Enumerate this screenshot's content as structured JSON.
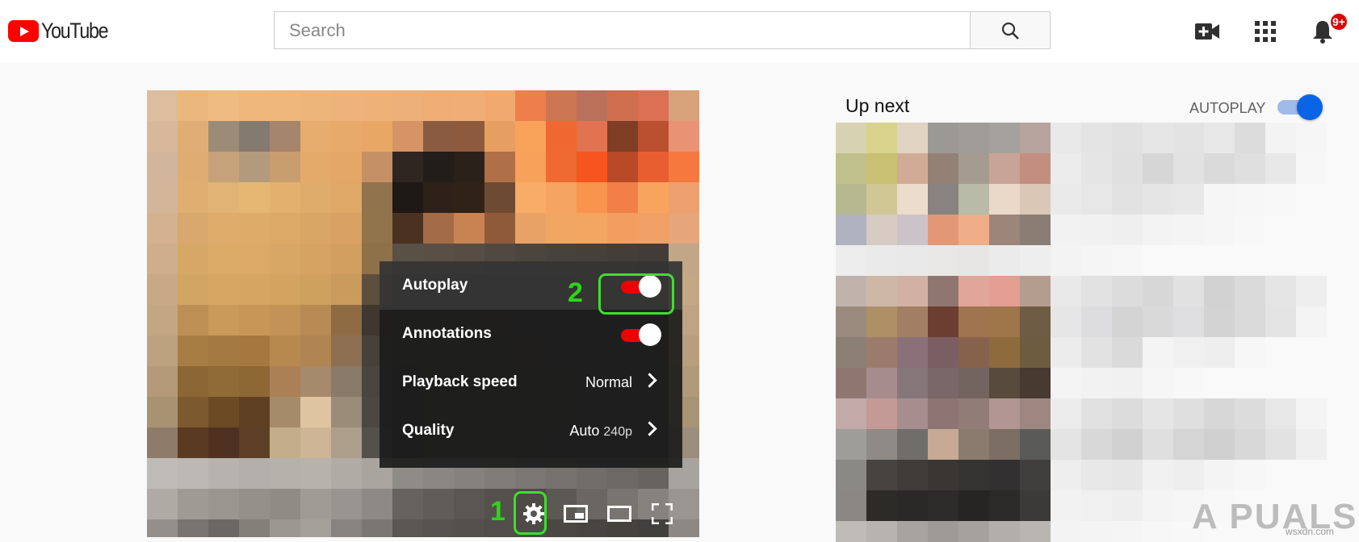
{
  "header": {
    "brand": "YouTube",
    "search_placeholder": "Search",
    "notification_count": "9+",
    "icons": [
      "youtube-logo-icon",
      "search-icon",
      "create-video-icon",
      "apps-grid-icon",
      "notifications-bell-icon"
    ]
  },
  "settings_menu": {
    "items": [
      {
        "label": "Autoplay",
        "type": "toggle",
        "on": true
      },
      {
        "label": "Annotations",
        "type": "toggle",
        "on": true
      },
      {
        "label": "Playback speed",
        "value": "Normal"
      },
      {
        "label": "Quality",
        "value": "Auto",
        "value_suffix": "240p"
      }
    ]
  },
  "annotations": {
    "step1": "1",
    "step2": "2",
    "highlight_color": "#3ce02a"
  },
  "controls": {
    "icons": [
      "settings-gear-icon",
      "miniplayer-icon",
      "theater-mode-icon",
      "fullscreen-icon"
    ]
  },
  "up_next": {
    "title": "Up next",
    "autoplay_label": "AUTOPLAY",
    "autoplay_on": true
  },
  "watermark": {
    "text": "A PUALS",
    "site": "wsxdn.com"
  },
  "colors": {
    "youtube_red": "#ff0000",
    "toggle_red": "#e00000",
    "autoplay_blue": "#0b63e5"
  }
}
